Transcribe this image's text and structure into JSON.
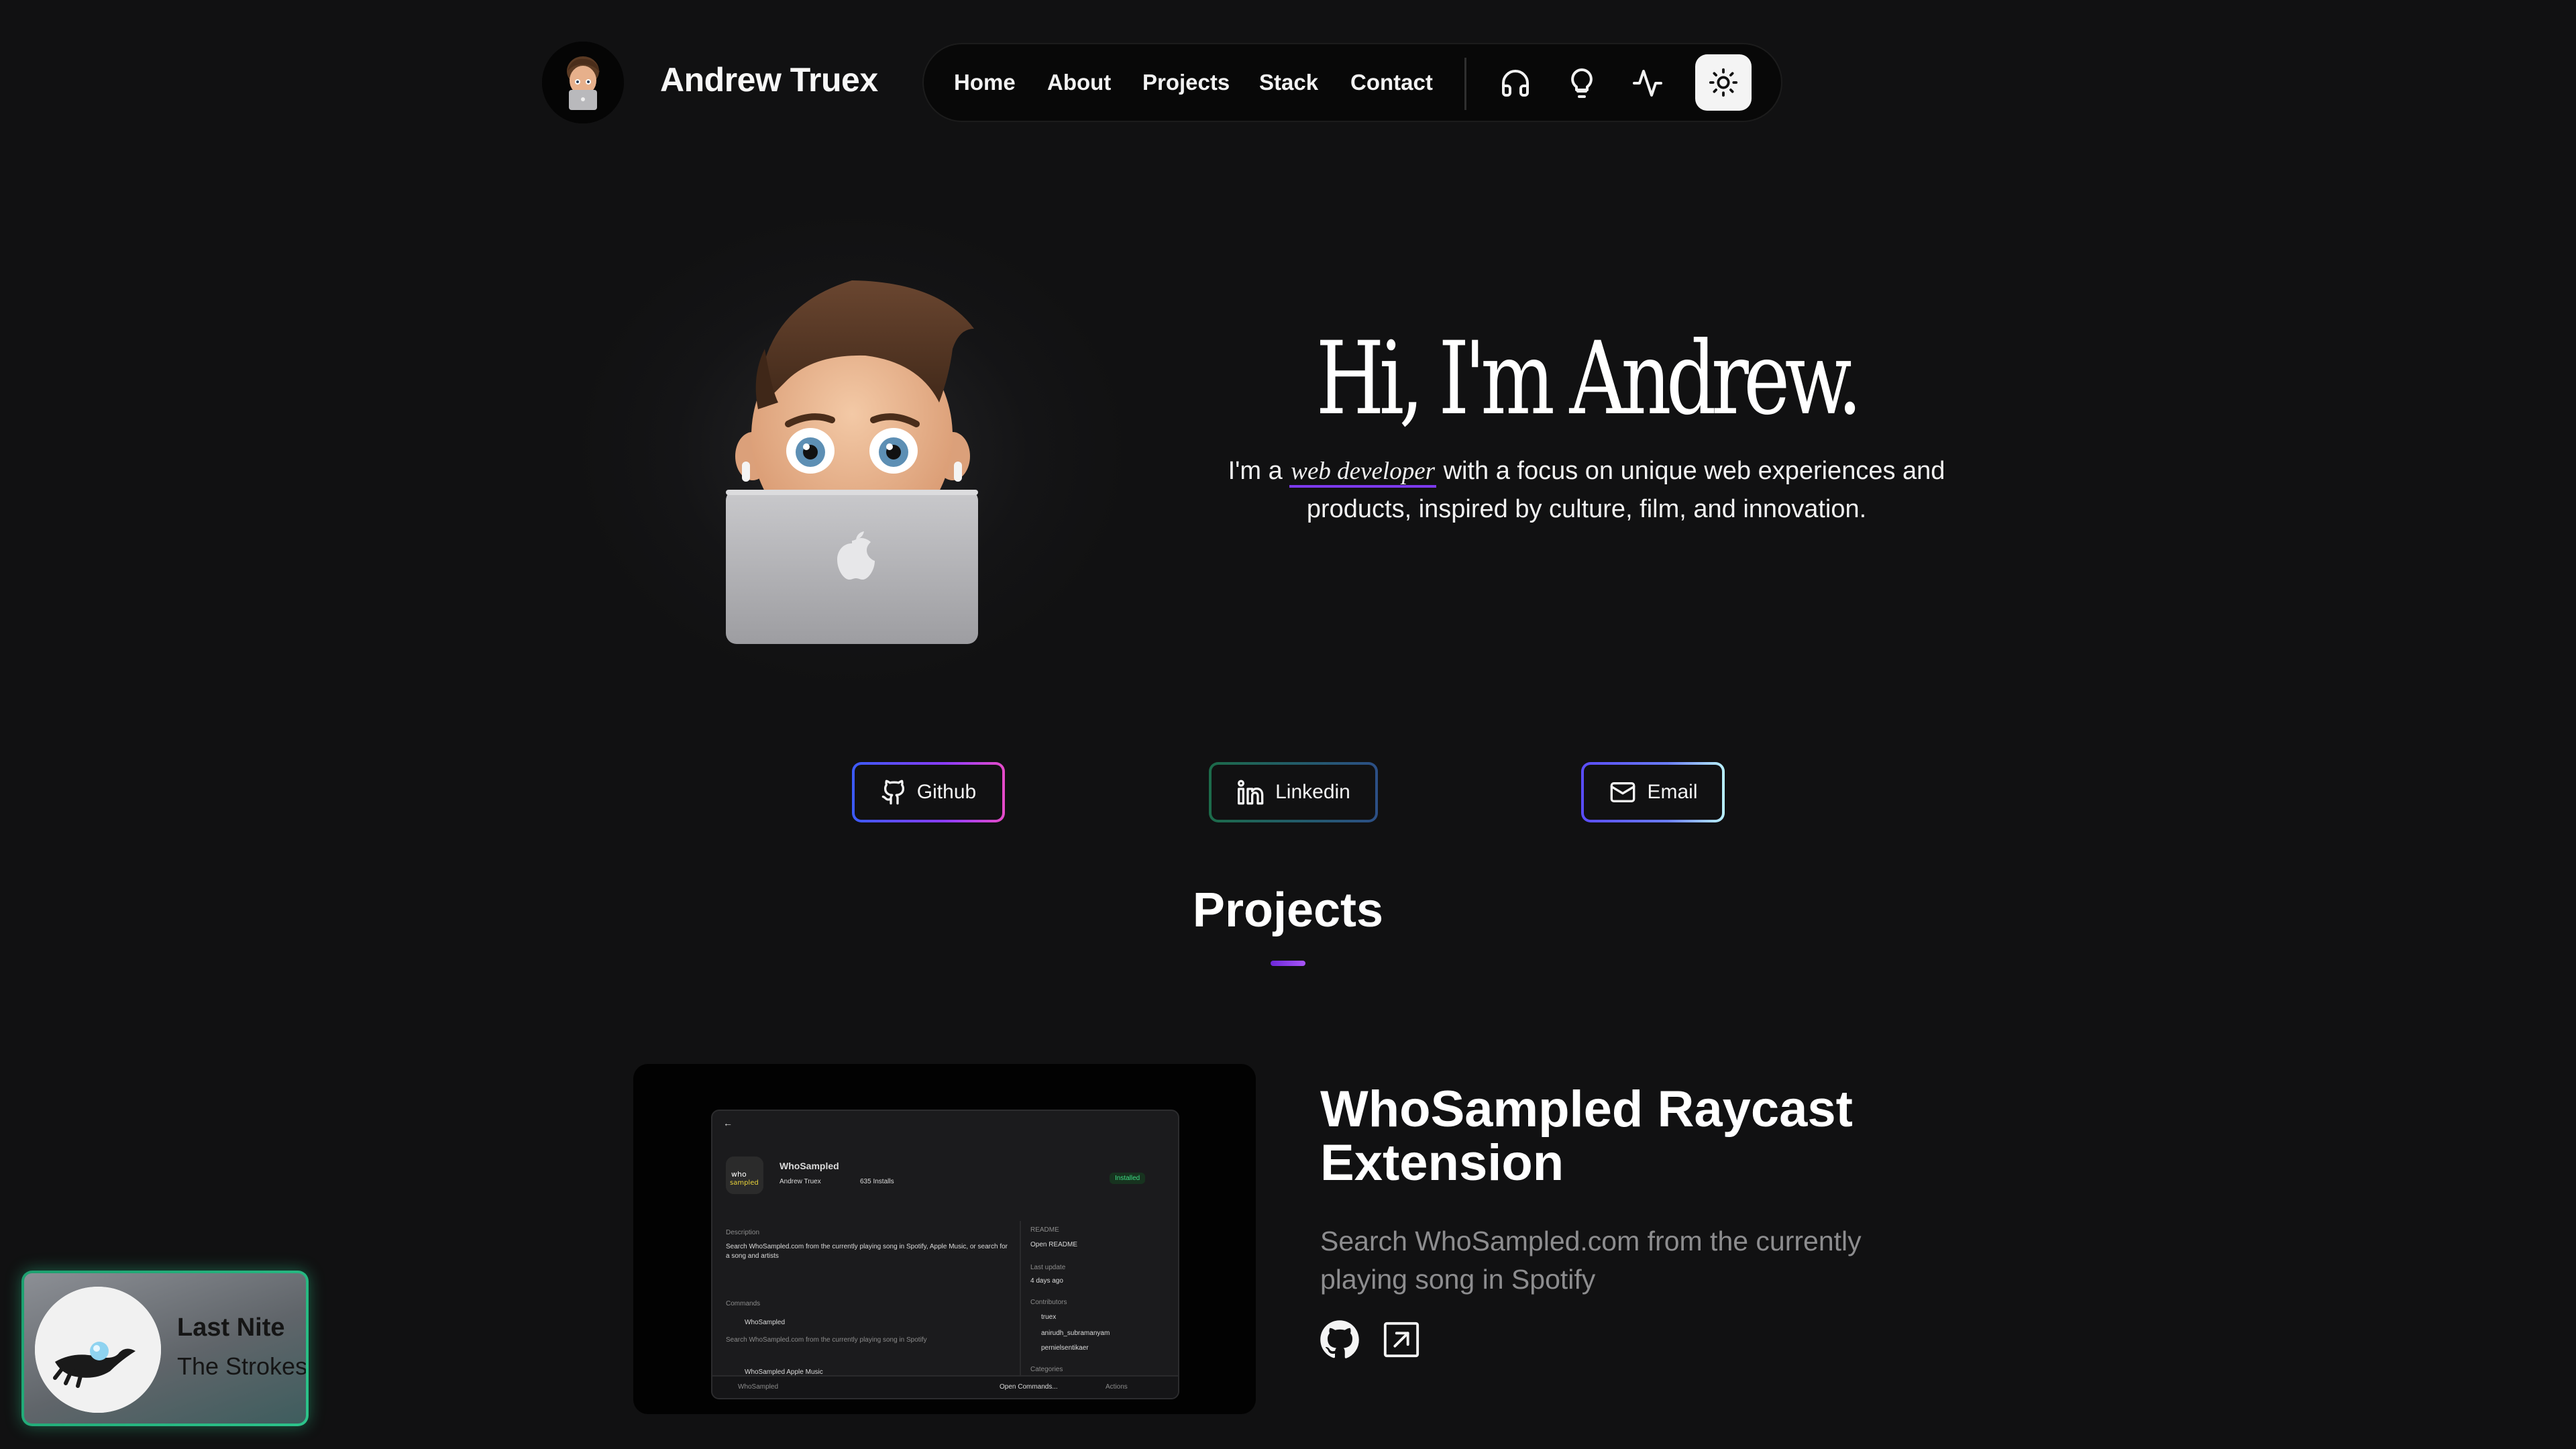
{
  "header": {
    "site_name": "Andrew Truex",
    "nav": [
      "Home",
      "About",
      "Projects",
      "Stack",
      "Contact"
    ],
    "icons": [
      "headphones-icon",
      "lightbulb-icon",
      "activity-icon",
      "sun-icon"
    ]
  },
  "hero": {
    "title": "Hi, I'm Andrew.",
    "intro_before": "I'm a",
    "intro_highlight": "web developer",
    "intro_after": "with a focus on unique web experiences and products, inspired by culture, film, and innovation."
  },
  "social": {
    "github": "Github",
    "linkedin": "Linkedin",
    "email": "Email"
  },
  "projects": {
    "heading": "Projects",
    "items": [
      {
        "title": "WhoSampled Raycast Extension",
        "description": "Search WhoSampled.com from the currently playing song in Spotify",
        "screenshot": {
          "name": "WhoSampled",
          "author": "Andrew Truex",
          "installs": "635 Installs",
          "badge": "Installed",
          "description_label": "Description",
          "description_text": "Search WhoSampled.com from the currently playing song in Spotify, Apple Music, or search for a song and artists",
          "commands_label": "Commands",
          "command_1": "WhoSampled",
          "command_1_desc": "Search WhoSampled.com from the currently playing song in Spotify",
          "command_2": "WhoSampled Apple Music",
          "readme_label": "README",
          "readme_value": "Open README",
          "update_label": "Last update",
          "update_value": "4 days ago",
          "contributors_label": "Contributors",
          "contributors": [
            "truex",
            "anirudh_subramanyam",
            "pernielsentikaer"
          ],
          "categories_label": "Categories",
          "footer_left": "WhoSampled",
          "footer_mid": "Open Commands...",
          "footer_right": "Actions"
        }
      }
    ]
  },
  "now_playing": {
    "title": "Last Nite",
    "artist": "The Strokes"
  },
  "colors": {
    "background": "#111112",
    "accent_purple": "#7c3aed",
    "now_playing_glow": "#2cc48b"
  }
}
